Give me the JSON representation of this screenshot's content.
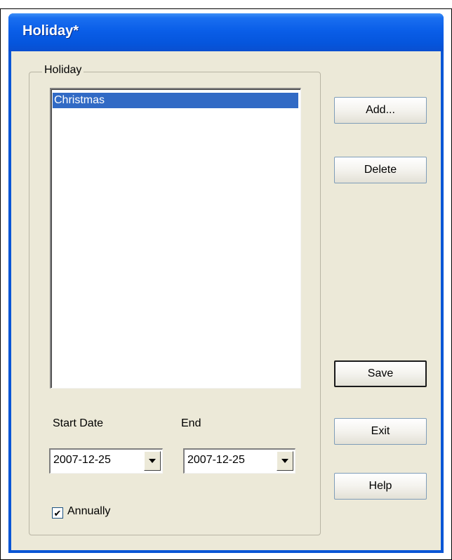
{
  "window": {
    "title": "Holiday*"
  },
  "group": {
    "label": "Holiday"
  },
  "holiday_list": {
    "items": [
      {
        "label": "Christmas",
        "selected": true
      }
    ]
  },
  "buttons": {
    "add": "Add...",
    "delete": "Delete",
    "save": "Save",
    "exit": "Exit",
    "help": "Help"
  },
  "start_date": {
    "label": "Start Date",
    "value": "2007-12-25"
  },
  "end_date": {
    "label": "End",
    "value": "2007-12-25"
  },
  "annually": {
    "label": "Annually",
    "checked": true
  },
  "colors": {
    "titlebar": "#0a5ee8",
    "selection": "#316ac5",
    "dialog_bg": "#ece9d8"
  },
  "icons": {
    "combo_arrow": "chevron-down-icon",
    "checkbox_mark": "checkmark-icon"
  }
}
